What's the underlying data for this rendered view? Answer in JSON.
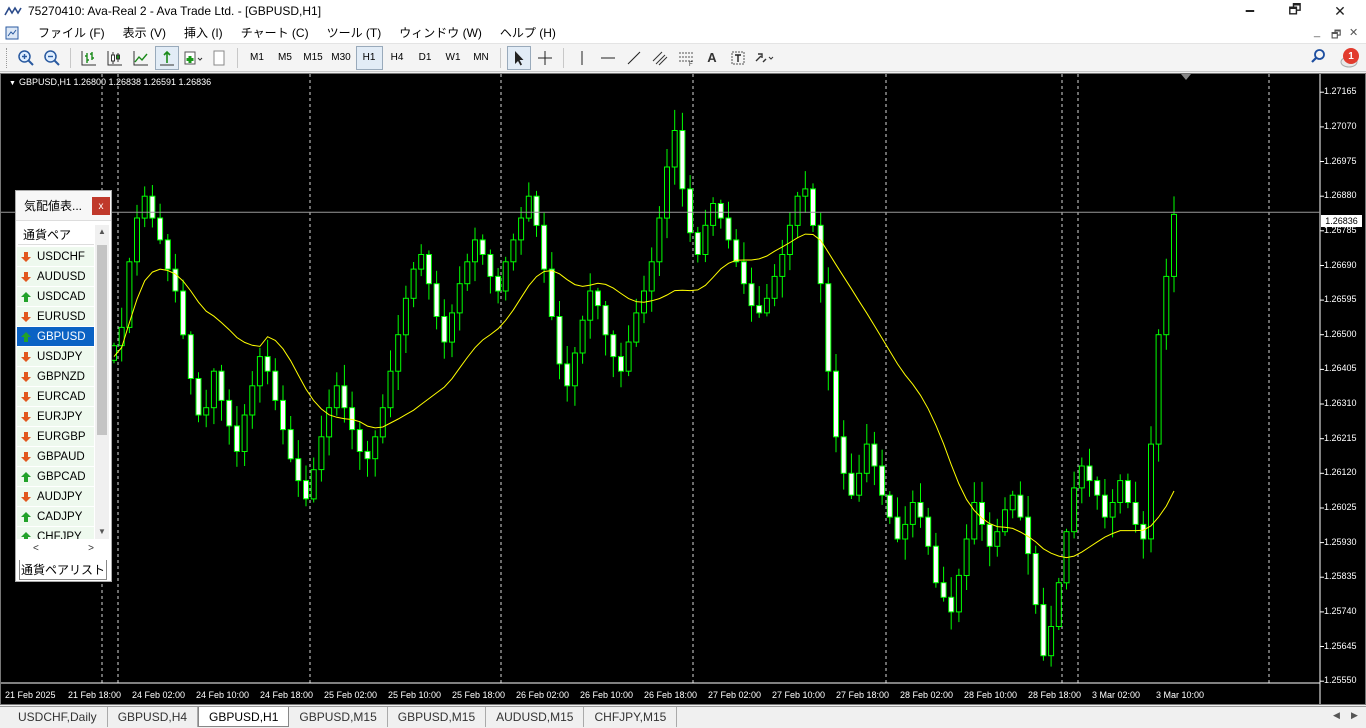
{
  "window": {
    "title": "75270410: Ava-Real 2 - Ava Trade Ltd. - [GBPUSD,H1]",
    "minimize": "🗕",
    "restore": "🗗",
    "close": "✕"
  },
  "menu": {
    "items": [
      "ファイル (F)",
      "表示 (V)",
      "挿入 (I)",
      "チャート (C)",
      "ツール (T)",
      "ウィンドウ (W)",
      "ヘルプ (H)"
    ],
    "mdi_minimize": "_",
    "mdi_restore": "🗗",
    "mdi_close": "✕"
  },
  "toolbar": {
    "timeframes": [
      "M1",
      "M5",
      "M15",
      "M30",
      "H1",
      "H4",
      "D1",
      "W1",
      "MN"
    ],
    "active_timeframe": "H1",
    "notification_count": "1",
    "text_tool": "A"
  },
  "market_watch": {
    "title": "気配値表...",
    "close": "x",
    "column_header": "通貨ペア",
    "selected": "GBPUSD",
    "symbols": [
      {
        "name": "USDCHF",
        "direction": "down"
      },
      {
        "name": "AUDUSD",
        "direction": "down"
      },
      {
        "name": "USDCAD",
        "direction": "up"
      },
      {
        "name": "EURUSD",
        "direction": "down"
      },
      {
        "name": "GBPUSD",
        "direction": "up"
      },
      {
        "name": "USDJPY",
        "direction": "down"
      },
      {
        "name": "GBPNZD",
        "direction": "down"
      },
      {
        "name": "EURCAD",
        "direction": "down"
      },
      {
        "name": "EURJPY",
        "direction": "down"
      },
      {
        "name": "EURGBP",
        "direction": "down"
      },
      {
        "name": "GBPAUD",
        "direction": "down"
      },
      {
        "name": "GBPCAD",
        "direction": "up"
      },
      {
        "name": "AUDJPY",
        "direction": "down"
      },
      {
        "name": "CADJPY",
        "direction": "up"
      },
      {
        "name": "CHFJPY",
        "direction": "up"
      }
    ],
    "tab_label": "通貨ペアリスト",
    "scroll_left": "<",
    "scroll_right": ">"
  },
  "chart": {
    "header": "GBPUSD,H1  1.26800 1.26838 1.26591 1.26836",
    "current_price": "1.26836",
    "colors": {
      "bull": "#00ff00",
      "bear": "#00ff00",
      "ma": "#ffff00",
      "grid": "#ffffff"
    }
  },
  "chart_data": {
    "type": "candlestick",
    "symbol": "GBPUSD",
    "timeframe": "H1",
    "ohlc_header": {
      "open": 1.268,
      "high": 1.26838,
      "low": 1.26591,
      "close": 1.26836
    },
    "ylim": [
      1.25545,
      1.27215
    ],
    "y_ticks": [
      "1.27165",
      "1.27070",
      "1.26975",
      "1.26880",
      "1.26785",
      "1.26690",
      "1.26595",
      "1.26500",
      "1.26405",
      "1.26310",
      "1.26215",
      "1.26120",
      "1.26025",
      "1.25930",
      "1.25835",
      "1.25740",
      "1.25645",
      "1.25550"
    ],
    "x_ticks": [
      "21 Feb 2025",
      "21 Feb 18:00",
      "24 Feb 02:00",
      "24 Feb 10:00",
      "24 Feb 18:00",
      "25 Feb 02:00",
      "25 Feb 10:00",
      "25 Feb 18:00",
      "26 Feb 02:00",
      "26 Feb 10:00",
      "26 Feb 18:00",
      "27 Feb 02:00",
      "27 Feb 10:00",
      "27 Feb 18:00",
      "28 Feb 02:00",
      "28 Feb 10:00",
      "28 Feb 18:00",
      "3 Mar 02:00",
      "3 Mar 10:00"
    ],
    "closes": [
      1.2647,
      1.2652,
      1.267,
      1.2682,
      1.2688,
      1.2682,
      1.2676,
      1.2668,
      1.2662,
      1.265,
      1.2638,
      1.2628,
      1.263,
      1.264,
      1.2632,
      1.2625,
      1.2618,
      1.2628,
      1.2636,
      1.2644,
      1.264,
      1.2632,
      1.2624,
      1.2616,
      1.261,
      1.2605,
      1.2613,
      1.2622,
      1.263,
      1.2636,
      1.263,
      1.2624,
      1.2618,
      1.2616,
      1.2622,
      1.263,
      1.264,
      1.265,
      1.266,
      1.2668,
      1.2672,
      1.2664,
      1.2655,
      1.2648,
      1.2656,
      1.2664,
      1.267,
      1.2676,
      1.2672,
      1.2666,
      1.2662,
      1.267,
      1.2676,
      1.2682,
      1.2688,
      1.268,
      1.2668,
      1.2655,
      1.2642,
      1.2636,
      1.2645,
      1.2654,
      1.2662,
      1.2658,
      1.265,
      1.2644,
      1.264,
      1.2648,
      1.2656,
      1.2662,
      1.267,
      1.2682,
      1.2696,
      1.2706,
      1.269,
      1.2678,
      1.2672,
      1.268,
      1.2686,
      1.2682,
      1.2676,
      1.267,
      1.2664,
      1.2658,
      1.2656,
      1.266,
      1.2666,
      1.2672,
      1.268,
      1.2688,
      1.269,
      1.268,
      1.2664,
      1.264,
      1.2622,
      1.2612,
      1.2606,
      1.2612,
      1.262,
      1.2614,
      1.2606,
      1.26,
      1.2594,
      1.2598,
      1.2604,
      1.26,
      1.2592,
      1.2582,
      1.2578,
      1.2574,
      1.2584,
      1.2594,
      1.2604,
      1.2598,
      1.2592,
      1.2596,
      1.2602,
      1.2606,
      1.26,
      1.259,
      1.2576,
      1.2562,
      1.257,
      1.2582,
      1.2596,
      1.2608,
      1.2614,
      1.261,
      1.2606,
      1.26,
      1.2604,
      1.261,
      1.2604,
      1.2598,
      1.2594,
      1.262,
      1.265,
      1.2666,
      1.2683
    ]
  },
  "bottom_tabs": {
    "items": [
      "USDCHF,Daily",
      "GBPUSD,H4",
      "GBPUSD,H1",
      "GBPUSD,M15",
      "GBPUSD,M15",
      "AUDUSD,M15",
      "CHFJPY,M15"
    ],
    "active_index": 2,
    "nav_left": "◀",
    "nav_right": "▶"
  }
}
